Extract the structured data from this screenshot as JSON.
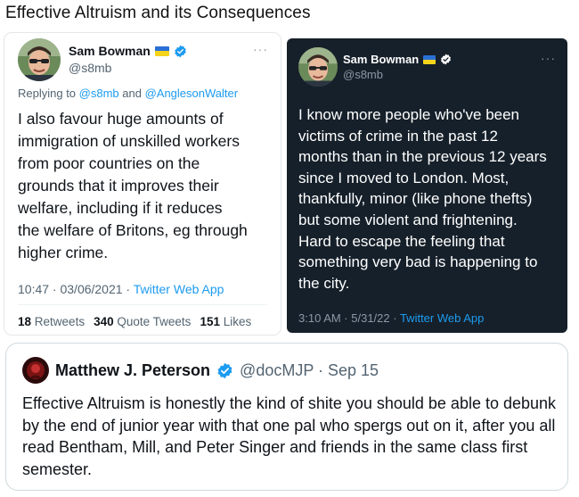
{
  "page": {
    "title": "Effective Altruism and its Consequences"
  },
  "tweet_left": {
    "name": "Sam Bowman",
    "handle": "@s8mb",
    "more": "···",
    "reply_prefix": "Replying to ",
    "reply_mention_1": "@s8mb",
    "reply_and": " and ",
    "reply_mention_2": "@AnglesonWalter",
    "text": "I also favour huge amounts of\nimmigration of unskilled workers\nfrom poor countries on the\ngrounds that it improves their\nwelfare, including if it reduces\nthe welfare of Britons, eg through\nhigher crime.",
    "time": "10:47 · 03/06/2021 · ",
    "app": "Twitter Web App",
    "retweets_count": "18",
    "retweets_label": "Retweets",
    "quotes_count": "340",
    "quotes_label": "Quote Tweets",
    "likes_count": "151",
    "likes_label": "Likes"
  },
  "tweet_right": {
    "name": "Sam Bowman",
    "handle": "@s8mb",
    "more": "···",
    "text": "I know more people who've been\nvictims of crime in the past 12\nmonths than in the previous 12 years\nsince I moved to London. Most,\nthankfully, minor (like phone thefts)\nbut some violent and frightening.\nHard to escape the feeling that\nsomething very bad is happening to\nthe city.",
    "time": "3:10 AM · 5/31/22 · ",
    "app": "Twitter Web App"
  },
  "quote_tweet": {
    "name": "Matthew J. Peterson",
    "handle_date": "@docMJP · Sep 15",
    "text": "Effective Altruism is honestly the kind of shite you should be able to debunk by the end of junior year with that one pal who spergs out on it, after you all read Bentham, Mill, and Peter Singer and friends in the same class first semester."
  },
  "colors": {
    "accent": "#1d9bf0",
    "dark_card": "#16202a",
    "verified": "#1d9bf0",
    "flag_blue": "#2a6fd6",
    "flag_yellow": "#f5d31b"
  },
  "icons": {
    "verified": "verified-badge-icon",
    "flag": "ukraine-flag-icon",
    "more": "more-options-icon"
  }
}
